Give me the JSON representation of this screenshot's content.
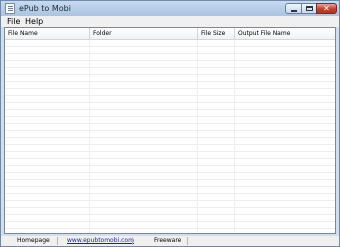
{
  "window": {
    "title": "ePub to Mobi"
  },
  "menu": {
    "items": [
      "File",
      "Help"
    ]
  },
  "list": {
    "columns": [
      "File Name",
      "Folder",
      "File Size",
      "Output File Name"
    ],
    "rows": []
  },
  "status": {
    "homepage_label": "Homepage",
    "url": "www.epubtomobi.com",
    "license": "Freeware"
  },
  "icons": {
    "app": "document-icon",
    "minimize": "minimize-icon",
    "maximize": "maximize-icon",
    "close": "close-icon"
  },
  "colors": {
    "title_bar": "#b9d0ea",
    "close_button": "#c0412d",
    "link": "#1b1ba8"
  }
}
